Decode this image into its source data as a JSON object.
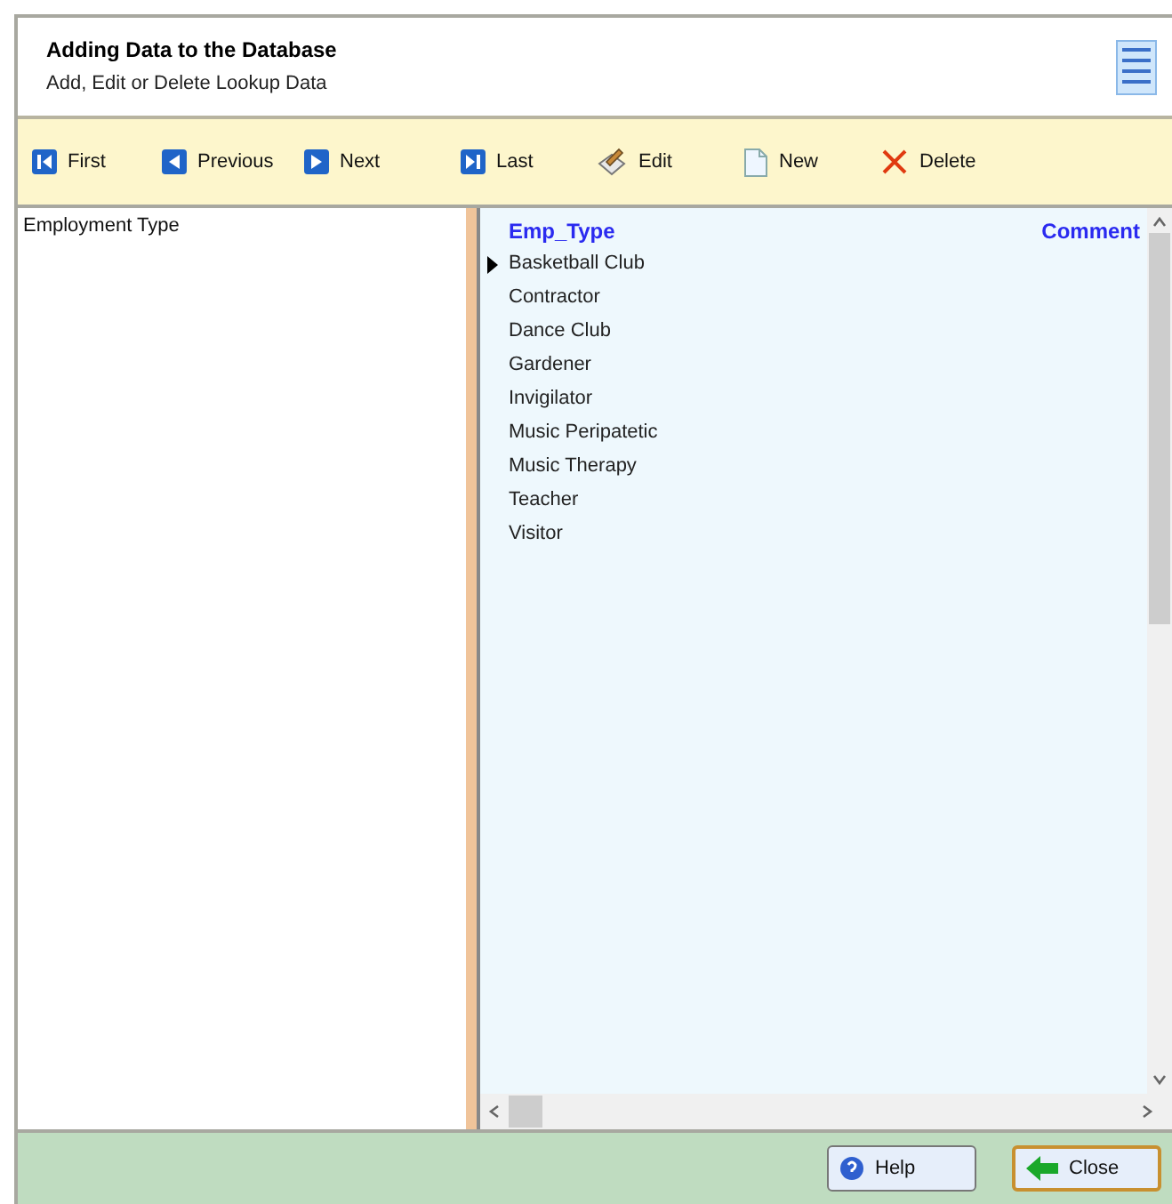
{
  "header": {
    "title": "Adding Data to the Database",
    "subtitle": "Add, Edit or Delete Lookup Data"
  },
  "toolbar": [
    {
      "label": "First",
      "kind": "first"
    },
    {
      "label": "Previous",
      "kind": "previous"
    },
    {
      "label": "Next",
      "kind": "next"
    },
    {
      "label": "Last",
      "kind": "last"
    },
    {
      "label": "Edit",
      "kind": "edit"
    },
    {
      "label": "New",
      "kind": "new"
    },
    {
      "label": "Delete",
      "kind": "delete"
    }
  ],
  "lookup_list": {
    "items": [
      {
        "label": "Employment Type",
        "selected": false
      }
    ]
  },
  "grid": {
    "columns": [
      "Emp_Type",
      "Comment"
    ],
    "rows": [
      {
        "emp_type": "Basketball Club",
        "current": true
      },
      {
        "emp_type": "Contractor",
        "current": false
      },
      {
        "emp_type": "Dance Club",
        "current": false
      },
      {
        "emp_type": "Gardener",
        "current": false
      },
      {
        "emp_type": "Invigilator",
        "current": false
      },
      {
        "emp_type": "Music Peripatetic",
        "current": false
      },
      {
        "emp_type": "Music Therapy",
        "current": false
      },
      {
        "emp_type": "Teacher",
        "current": false
      },
      {
        "emp_type": "Visitor",
        "current": false
      }
    ]
  },
  "buttons": [
    {
      "label": "Help",
      "kind": "help",
      "selected": false
    },
    {
      "label": "Close",
      "kind": "close",
      "selected": true
    }
  ]
}
